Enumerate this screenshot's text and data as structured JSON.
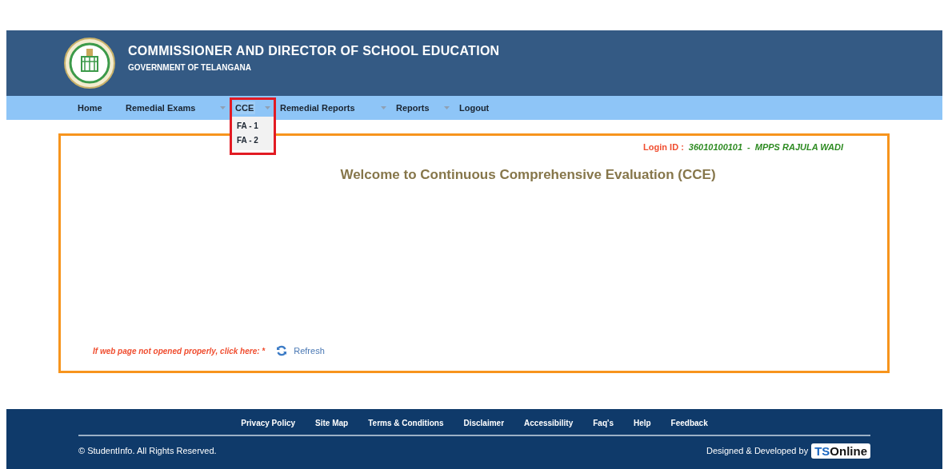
{
  "header": {
    "title": "COMMISSIONER AND DIRECTOR OF SCHOOL EDUCATION",
    "subtitle": "GOVERNMENT OF TELANGANA"
  },
  "nav": [
    {
      "label": "Home",
      "dropdown": false,
      "expanded": false,
      "highlighted": false
    },
    {
      "label": "Remedial Exams",
      "dropdown": true,
      "expanded": false,
      "highlighted": false
    },
    {
      "label": "CCE",
      "dropdown": true,
      "expanded": true,
      "highlighted": true,
      "children": [
        {
          "label": "FA - 1"
        },
        {
          "label": "FA - 2"
        }
      ]
    },
    {
      "label": "Remedial Reports",
      "dropdown": true,
      "expanded": false,
      "highlighted": false
    },
    {
      "label": "Reports",
      "dropdown": true,
      "expanded": false,
      "highlighted": false
    },
    {
      "label": "Logout",
      "dropdown": false,
      "expanded": false,
      "highlighted": false
    }
  ],
  "login": {
    "label": "Login ID :",
    "id": "36010100101",
    "separator": "-",
    "school": "MPPS RAJULA WADI"
  },
  "welcome": "Welcome to Continuous Comprehensive Evaluation (CCE)",
  "refresh": {
    "hint": "If web page not opened properly, click here: *",
    "button": "Refresh"
  },
  "footer": {
    "links": [
      "Privacy Policy",
      "Site Map",
      "Terms & Conditions",
      "Disclaimer",
      "Accessibility",
      "Faq's",
      "Help",
      "Feedback"
    ],
    "copyright": "© StudentInfo. All Rights Reserved.",
    "credit": "Designed & Developed by",
    "brand_prefix": "TS",
    "brand_suffix": "Online"
  }
}
